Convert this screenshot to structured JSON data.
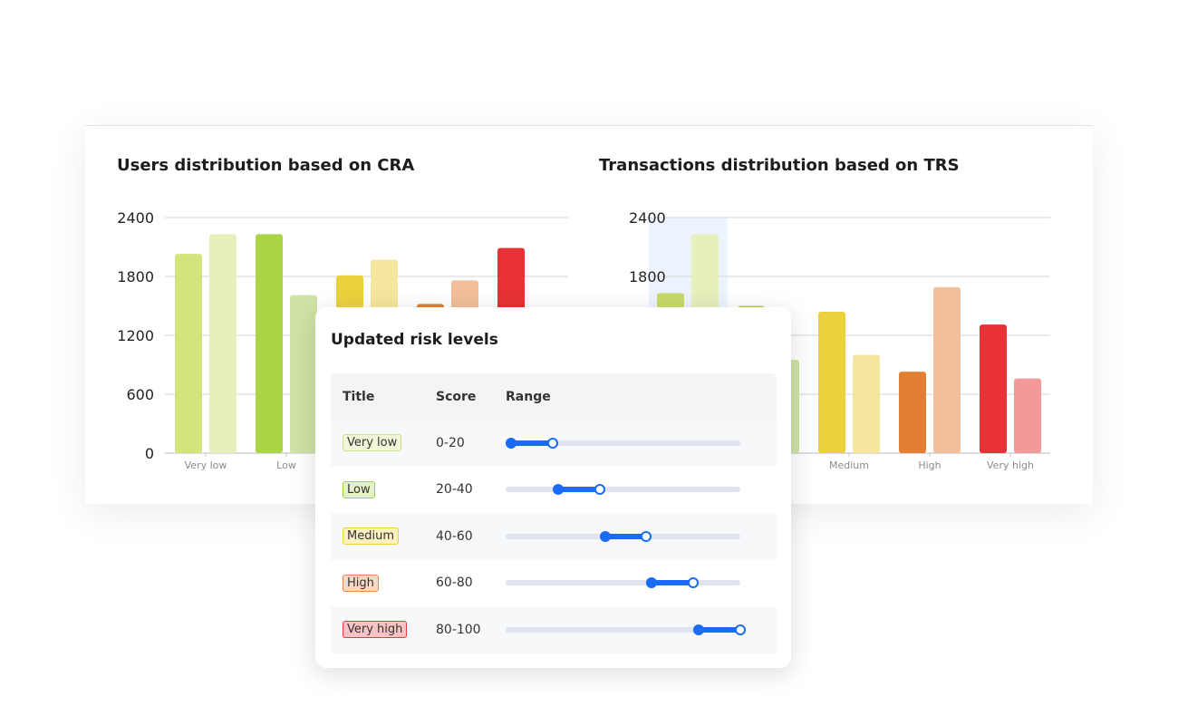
{
  "chart_data": [
    {
      "type": "bar",
      "title": "Users distribution based on CRA",
      "categories": [
        "Very low",
        "Low",
        "Medium",
        "High",
        "Very high"
      ],
      "yticks": [
        0,
        600,
        1200,
        1800,
        2400
      ],
      "ylim": [
        0,
        2400
      ],
      "grid": true,
      "series": [
        {
          "values": [
            2030,
            2230,
            1810,
            1520,
            2090
          ]
        },
        {
          "values": [
            2230,
            1610,
            1970,
            1760,
            null
          ]
        }
      ],
      "colors": [
        [
          "#d4e37a",
          "#e6f0bd"
        ],
        [
          "#abd447",
          "#cfe3a5"
        ],
        [
          "#ecd13e",
          "#f6e69d"
        ],
        [
          "#e27f33",
          "#f2bf98"
        ],
        [
          "#e83235",
          "#f29999"
        ]
      ]
    },
    {
      "type": "bar",
      "title": "Transactions distribution based on TRS",
      "categories": [
        "Very low",
        "Low",
        "Medium",
        "High",
        "Very high"
      ],
      "yticks": [
        0,
        600,
        1200,
        1800,
        2400
      ],
      "ylim": [
        0,
        2400
      ],
      "grid": true,
      "highlighted_category": "Very low",
      "series": [
        {
          "values": [
            1630,
            1500,
            1440,
            830,
            1310
          ]
        },
        {
          "values": [
            2230,
            950,
            1000,
            1690,
            760
          ]
        }
      ],
      "colors": [
        [
          "#c9da6a",
          "#e6f0bd"
        ],
        [
          "#b5d24a",
          "#cfe3a5"
        ],
        [
          "#ecd13e",
          "#f6e69d"
        ],
        [
          "#e27f33",
          "#f2bf98"
        ],
        [
          "#e83235",
          "#f29999"
        ]
      ]
    }
  ],
  "dialog": {
    "title": "Updated risk levels",
    "headers": {
      "title": "Title",
      "score": "Score",
      "range": "Range"
    },
    "rows": [
      {
        "title": "Very low",
        "score": "0-20",
        "range": [
          0,
          20
        ],
        "bg": "#f0f6d8",
        "border": "#cfe28a"
      },
      {
        "title": "Low",
        "score": "20-40",
        "range": [
          20,
          40
        ],
        "bg": "#e3f1c6",
        "border": "#9fd24b"
      },
      {
        "title": "Medium",
        "score": "40-60",
        "range": [
          40,
          60
        ],
        "bg": "#fbf0c0",
        "border": "#ecd13e"
      },
      {
        "title": "High",
        "score": "60-80",
        "range": [
          60,
          80
        ],
        "bg": "#fad9c3",
        "border": "#e8894a"
      },
      {
        "title": "Very high",
        "score": "80-100",
        "range": [
          80,
          100
        ],
        "bg": "#f8c3c4",
        "border": "#e83a3c"
      }
    ]
  }
}
